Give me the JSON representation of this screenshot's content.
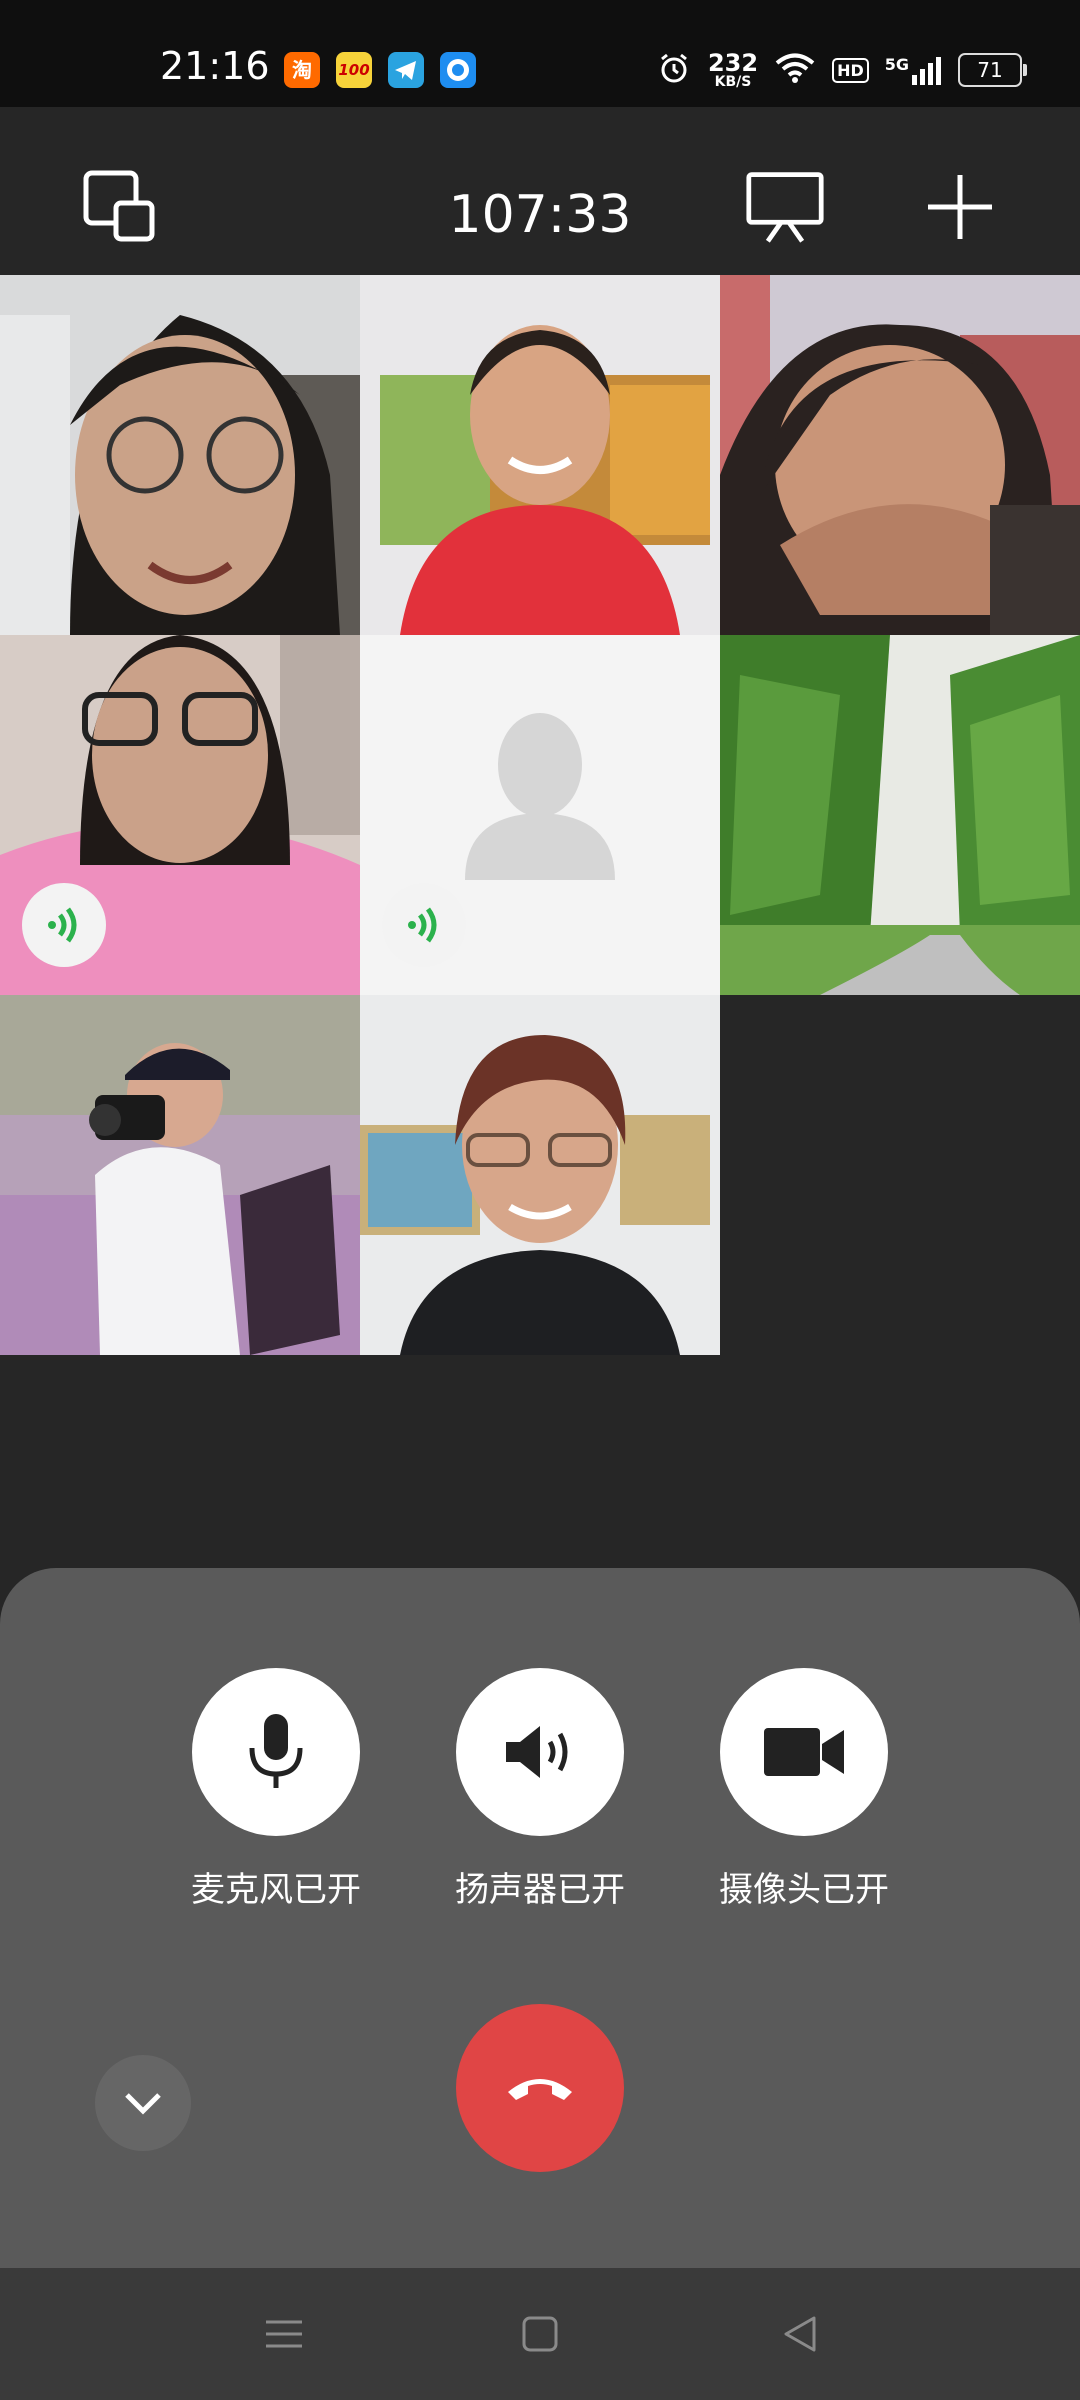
{
  "status_bar": {
    "time": "21:16",
    "notification_icons": [
      "taobao-icon",
      "100-icon",
      "telegram-icon",
      "browser-icon"
    ],
    "icon_text": {
      "taobao": "淘",
      "hundred": "100"
    },
    "net_speed_value": "232",
    "net_speed_unit": "KB/S",
    "hd_label": "HD",
    "network_label": "5G",
    "battery_level": "71"
  },
  "call": {
    "timer": "107:33",
    "icons": {
      "minimize": "floating-window-icon",
      "share_screen": "screen-share-icon",
      "add_member": "add-icon"
    }
  },
  "participants": [
    {
      "id": "p1",
      "video": true,
      "speaking": false
    },
    {
      "id": "p2",
      "video": true,
      "speaking": false
    },
    {
      "id": "p3",
      "video": true,
      "speaking": false
    },
    {
      "id": "p4",
      "video": true,
      "speaking": true
    },
    {
      "id": "p5",
      "video": false,
      "speaking": true
    },
    {
      "id": "p6",
      "video": true,
      "speaking": false
    },
    {
      "id": "p7",
      "video": true,
      "speaking": false
    },
    {
      "id": "p8",
      "video": true,
      "speaking": false
    }
  ],
  "controls": {
    "mic_label": "麦克风已开",
    "speaker_label": "扬声器已开",
    "camera_label": "摄像头已开"
  },
  "colors": {
    "hangup": "#e04545",
    "panel": "#5a5a5a",
    "background": "#262626",
    "speaking_green": "#2bb24c"
  }
}
